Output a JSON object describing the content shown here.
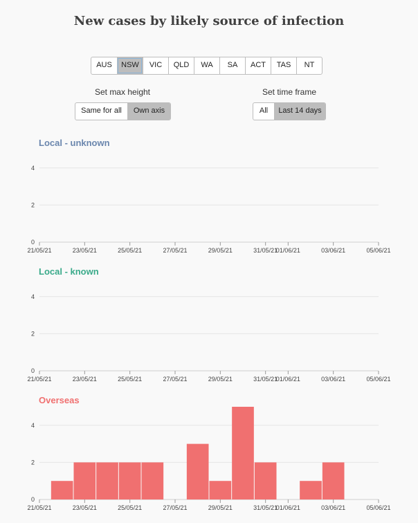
{
  "title": "New cases by likely source of infection",
  "states": [
    "AUS",
    "NSW",
    "VIC",
    "QLD",
    "WA",
    "SA",
    "ACT",
    "TAS",
    "NT"
  ],
  "selected_state": "NSW",
  "max_height": {
    "label": "Set max height",
    "options": [
      "Same for all",
      "Own axis"
    ],
    "selected": "Own axis"
  },
  "time_frame": {
    "label": "Set time frame",
    "options": [
      "All",
      "Last 14 days"
    ],
    "selected": "Last 14 days"
  },
  "chart_data": [
    {
      "type": "bar",
      "title": "Local - unknown",
      "color": "#6a86ad",
      "x_ticks": [
        "21/05/21",
        "23/05/21",
        "25/05/21",
        "27/05/21",
        "29/05/21",
        "31/05/21",
        "01/06/21",
        "03/06/21",
        "05/06/21"
      ],
      "y_ticks": [
        0,
        2,
        4
      ],
      "ylim": [
        0,
        5
      ],
      "categories": [
        "22/05/21",
        "23/05/21",
        "24/05/21",
        "25/05/21",
        "26/05/21",
        "27/05/21",
        "28/05/21",
        "29/05/21",
        "30/05/21",
        "31/05/21",
        "01/06/21",
        "02/06/21",
        "03/06/21",
        "04/06/21"
      ],
      "values": [
        0,
        0,
        0,
        0,
        0,
        0,
        0,
        0,
        0,
        0,
        0,
        0,
        0,
        0
      ]
    },
    {
      "type": "bar",
      "title": "Local - known",
      "color": "#3aaa8a",
      "x_ticks": [
        "21/05/21",
        "23/05/21",
        "25/05/21",
        "27/05/21",
        "29/05/21",
        "31/05/21",
        "01/06/21",
        "03/06/21",
        "05/06/21"
      ],
      "y_ticks": [
        0,
        2,
        4
      ],
      "ylim": [
        0,
        5
      ],
      "categories": [
        "22/05/21",
        "23/05/21",
        "24/05/21",
        "25/05/21",
        "26/05/21",
        "27/05/21",
        "28/05/21",
        "29/05/21",
        "30/05/21",
        "31/05/21",
        "01/06/21",
        "02/06/21",
        "03/06/21",
        "04/06/21"
      ],
      "values": [
        0,
        0,
        0,
        0,
        0,
        0,
        0,
        0,
        0,
        0,
        0,
        0,
        0,
        0
      ]
    },
    {
      "type": "bar",
      "title": "Overseas",
      "color": "#f07070",
      "x_ticks": [
        "21/05/21",
        "23/05/21",
        "25/05/21",
        "27/05/21",
        "29/05/21",
        "31/05/21",
        "01/06/21",
        "03/06/21",
        "05/06/21"
      ],
      "y_ticks": [
        0,
        2,
        4
      ],
      "ylim": [
        0,
        5
      ],
      "categories": [
        "22/05/21",
        "23/05/21",
        "24/05/21",
        "25/05/21",
        "26/05/21",
        "27/05/21",
        "28/05/21",
        "29/05/21",
        "30/05/21",
        "31/05/21",
        "01/06/21",
        "02/06/21",
        "03/06/21",
        "04/06/21"
      ],
      "values": [
        1,
        2,
        2,
        2,
        2,
        0,
        3,
        1,
        5,
        2,
        0,
        1,
        2,
        0
      ]
    }
  ]
}
